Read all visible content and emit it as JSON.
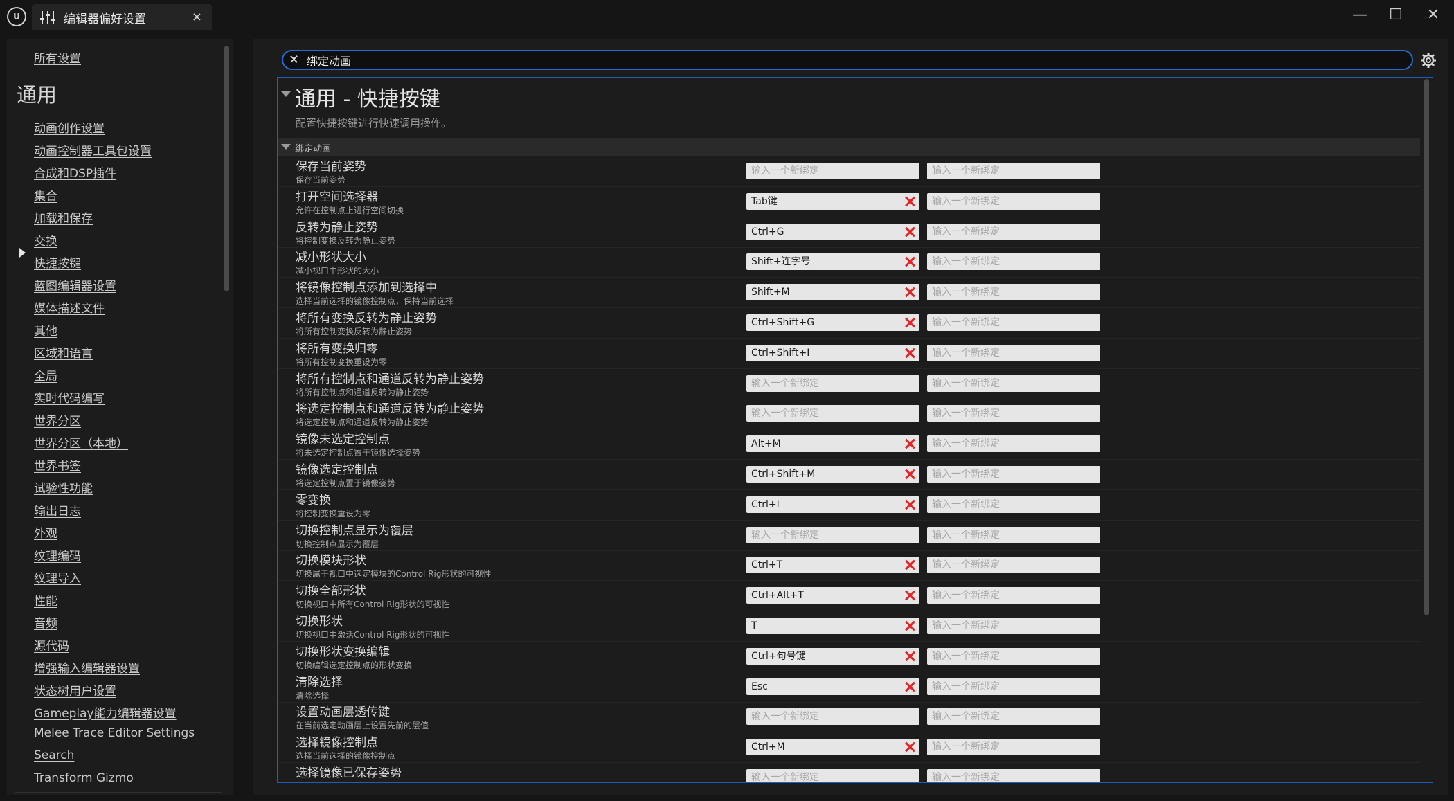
{
  "window": {
    "logo": "U",
    "tab_title": "编辑器偏好设置",
    "tab_close": "×",
    "minimize": "—",
    "maximize": "☐",
    "close": "✕"
  },
  "sidebar": {
    "all_settings": "所有设置",
    "section": "通用",
    "items": [
      "动画创作设置",
      "动画控制器工具包设置",
      "合成和DSP插件",
      "集合",
      "加载和保存",
      "交换",
      "快捷按键",
      "蓝图编辑器设置",
      "媒体描述文件",
      "其他",
      "区域和语言",
      "全局",
      "实时代码编写",
      "世界分区",
      "世界分区（本地）",
      "世界书签",
      "试验性功能",
      "输出日志",
      "外观",
      "纹理编码",
      "纹理导入",
      "性能",
      "音频",
      "源代码",
      "增强输入编辑器设置",
      "状态树用户设置",
      "Gameplay能力编辑器设置",
      "Melee Trace Editor Settings",
      "Search",
      "Transform Gizmo"
    ],
    "selected_item": "快捷按键"
  },
  "search": {
    "value": "绑定动画",
    "clear_glyph": "✕"
  },
  "section": {
    "title": "通用 - 快捷按键",
    "description": "配置快捷按键进行快速调用操作。",
    "category": "绑定动画",
    "placeholder": "输入一个新绑定"
  },
  "rows": [
    {
      "name": "保存当前姿势",
      "desc": "保存当前姿势",
      "binding": ""
    },
    {
      "name": "打开空间选择器",
      "desc": "允许在控制点上进行空间切换",
      "binding": "Tab键"
    },
    {
      "name": "反转为静止姿势",
      "desc": "将控制变换反转为静止姿势",
      "binding": "Ctrl+G"
    },
    {
      "name": "减小形状大小",
      "desc": "减小视口中形状的大小",
      "binding": "Shift+连字号"
    },
    {
      "name": "将镜像控制点添加到选择中",
      "desc": "选择当前选择的镜像控制点，保持当前选择",
      "binding": "Shift+M"
    },
    {
      "name": "将所有变换反转为静止姿势",
      "desc": "将所有控制变换反转为静止姿势",
      "binding": "Ctrl+Shift+G"
    },
    {
      "name": "将所有变换归零",
      "desc": "将所有控制变换重设为零",
      "binding": "Ctrl+Shift+I"
    },
    {
      "name": "将所有控制点和通道反转为静止姿势",
      "desc": "将所有控制点和通道反转为静止姿势",
      "binding": ""
    },
    {
      "name": "将选定控制点和通道反转为静止姿势",
      "desc": "将选定控制点和通道反转为静止姿势",
      "binding": ""
    },
    {
      "name": "镜像未选定控制点",
      "desc": "将未选定控制点置于镜像选择姿势",
      "binding": "Alt+M"
    },
    {
      "name": "镜像选定控制点",
      "desc": "将选定控制点置于镜像姿势",
      "binding": "Ctrl+Shift+M"
    },
    {
      "name": "零变换",
      "desc": "将控制变换重设为零",
      "binding": "Ctrl+I"
    },
    {
      "name": "切换控制点显示为覆层",
      "desc": "切换控制点显示为覆层",
      "binding": ""
    },
    {
      "name": "切换模块形状",
      "desc": "切换属于视口中选定模块的Control Rig形状的可视性",
      "binding": "Ctrl+T"
    },
    {
      "name": "切换全部形状",
      "desc": "切换视口中所有Control Rig形状的可视性",
      "binding": "Ctrl+Alt+T"
    },
    {
      "name": "切换形状",
      "desc": "切换视口中激活Control Rig形状的可视性",
      "binding": "T"
    },
    {
      "name": "切换形状变换编辑",
      "desc": "切换编辑选定控制点的形状变换",
      "binding": "Ctrl+句号键"
    },
    {
      "name": "清除选择",
      "desc": "清除选择",
      "binding": "Esc"
    },
    {
      "name": "设置动画层透传键",
      "desc": "在当前选定动画层上设置先前的层值",
      "binding": ""
    },
    {
      "name": "选择镜像控制点",
      "desc": "选择当前选择的镜像控制点",
      "binding": "Ctrl+M"
    },
    {
      "name": "选择镜像已保存姿势",
      "desc": "",
      "binding": ""
    }
  ]
}
